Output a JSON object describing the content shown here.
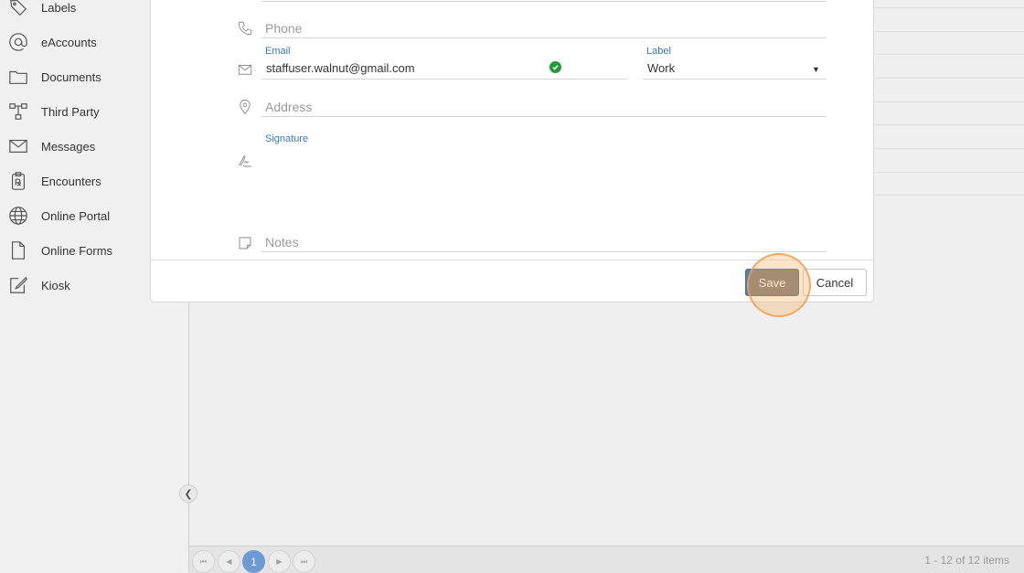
{
  "sidebar": {
    "items": [
      {
        "label": "Labels",
        "icon": "tag-icon"
      },
      {
        "label": "eAccounts",
        "icon": "at-icon"
      },
      {
        "label": "Documents",
        "icon": "folder-icon"
      },
      {
        "label": "Third Party",
        "icon": "network-icon"
      },
      {
        "label": "Messages",
        "icon": "envelope-icon"
      },
      {
        "label": "Encounters",
        "icon": "prescription-icon"
      },
      {
        "label": "Online Portal",
        "icon": "globe-icon"
      },
      {
        "label": "Online Forms",
        "icon": "document-icon"
      },
      {
        "label": "Kiosk",
        "icon": "edit-icon"
      }
    ]
  },
  "dialog": {
    "phone": {
      "placeholder": "Phone"
    },
    "email": {
      "label": "Email",
      "value": "staffuser.walnut@gmail.com",
      "verified": true
    },
    "email_type": {
      "label": "Label",
      "value": "Work"
    },
    "address": {
      "placeholder": "Address"
    },
    "signature": {
      "label": "Signature"
    },
    "notes": {
      "placeholder": "Notes"
    },
    "buttons": {
      "save": "Save",
      "cancel": "Cancel"
    }
  },
  "pager": {
    "current_page": "1",
    "info": "1 - 12 of 12 items"
  },
  "colors": {
    "accent": "#3a79b5",
    "save_button": "#4a7fb8",
    "verified": "#1f9d3a",
    "click_highlight": "#f6b26b"
  }
}
